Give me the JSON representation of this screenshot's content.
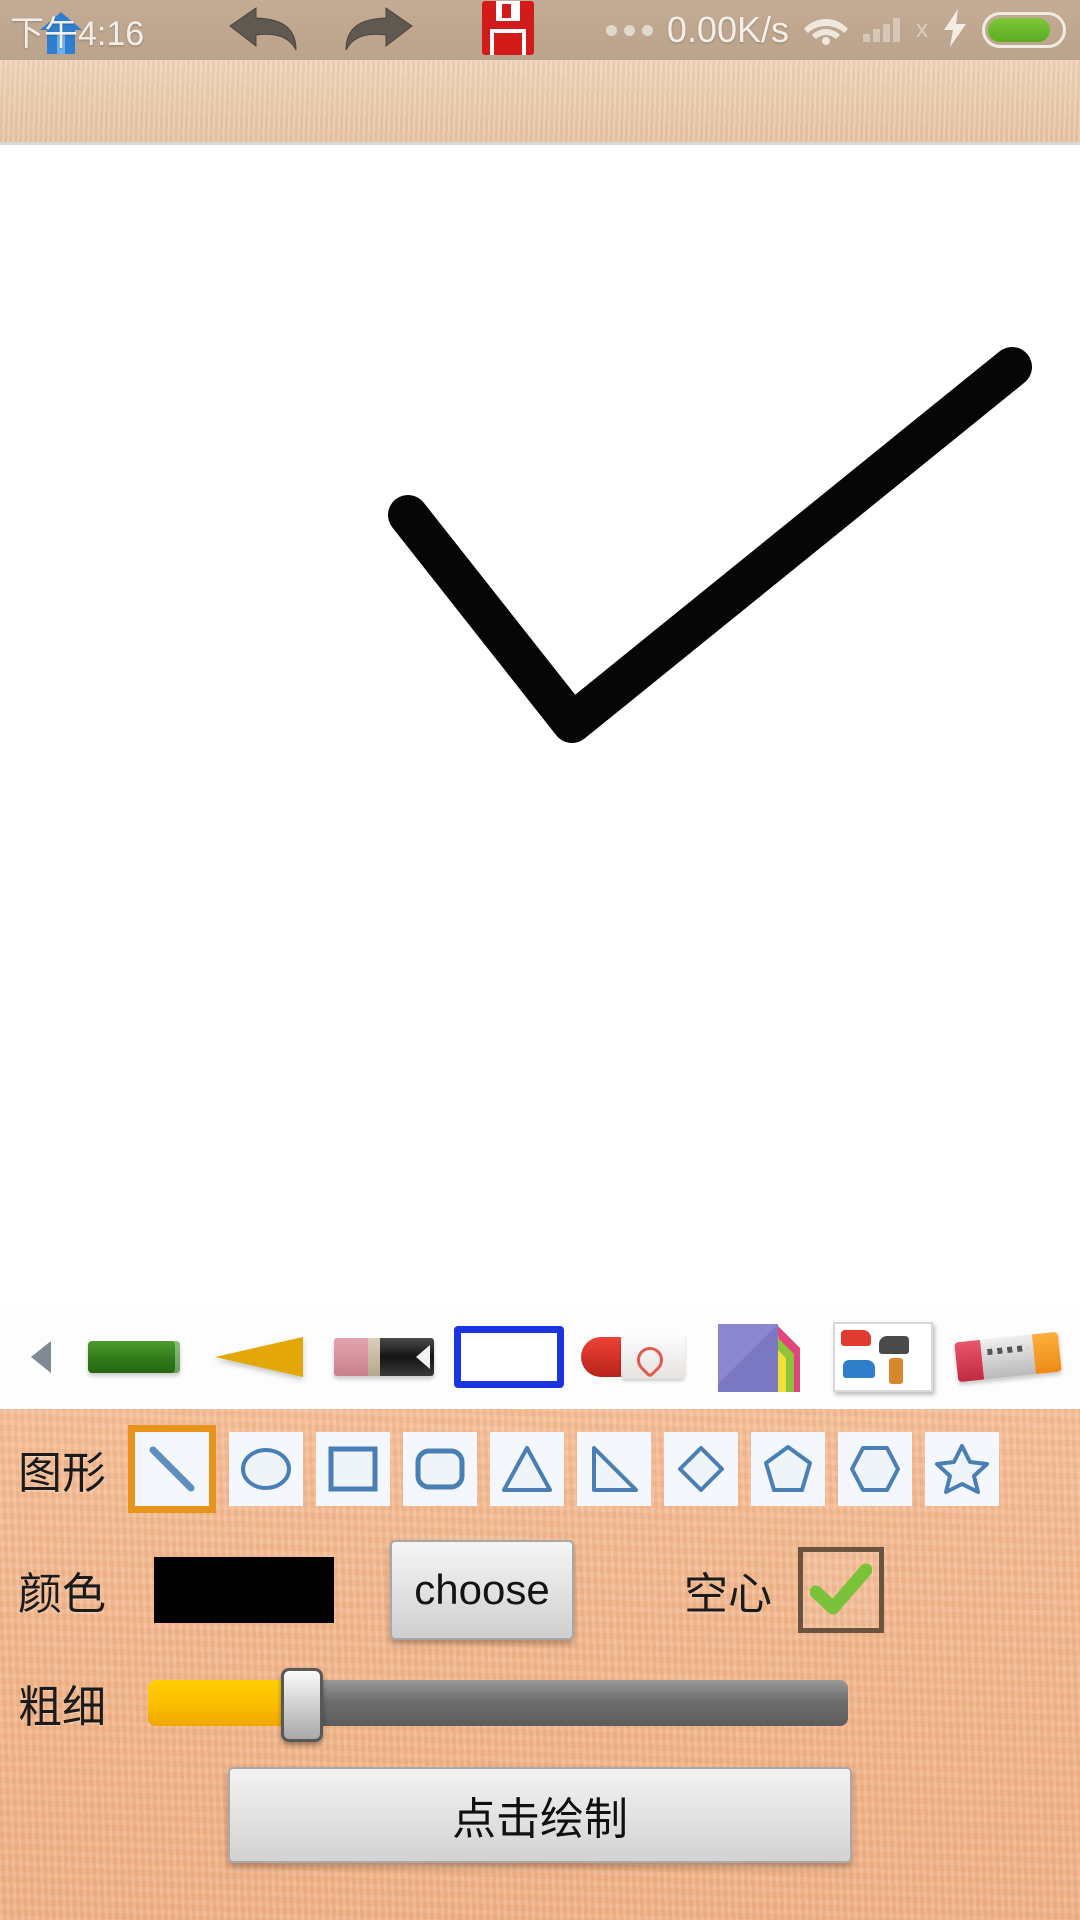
{
  "statusbar": {
    "time": "下午4:16",
    "network_speed": "0.00K/s",
    "overflow_dots": "…",
    "signal_x": "x",
    "icons": {
      "home": "home-icon",
      "wifi": "wifi-icon",
      "signal": "signal-icon",
      "charging": "charging-bolt-icon",
      "battery": "battery-icon"
    }
  },
  "appbar": {
    "undo": "undo-icon",
    "redo": "redo-icon",
    "save": "save-floppy-icon"
  },
  "canvas": {
    "stroke_color": "#000000",
    "content_description": "checkmark-stroke"
  },
  "toolstrip": {
    "back_label": "<",
    "tools": [
      {
        "name": "marker-tool"
      },
      {
        "name": "crayon-tool"
      },
      {
        "name": "pencil-eraser-tool"
      },
      {
        "name": "shape-rect-tool"
      },
      {
        "name": "paint-tube-tool"
      },
      {
        "name": "colored-paper-tool"
      },
      {
        "name": "sticker-photo-tool"
      },
      {
        "name": "glue-stick-tool"
      }
    ]
  },
  "panel": {
    "shape": {
      "label": "图形",
      "selected_index": 0,
      "selected_color": "#e8931c",
      "items": [
        {
          "name": "line-shape"
        },
        {
          "name": "ellipse-shape"
        },
        {
          "name": "square-shape"
        },
        {
          "name": "rounded-rect-shape"
        },
        {
          "name": "triangle-shape"
        },
        {
          "name": "right-triangle-shape"
        },
        {
          "name": "diamond-shape"
        },
        {
          "name": "pentagon-shape"
        },
        {
          "name": "hexagon-shape"
        },
        {
          "name": "star-shape"
        }
      ]
    },
    "color": {
      "label": "颜色",
      "value": "#000000",
      "choose_label": "choose"
    },
    "hollow": {
      "label": "空心",
      "checked": true,
      "check_color": "#7ac23a"
    },
    "thickness": {
      "label": "粗细",
      "percent": 22,
      "fill_color": "#fcc000",
      "track_color": "#6e6e6e"
    },
    "draw_button": {
      "label": "点击绘制"
    }
  }
}
